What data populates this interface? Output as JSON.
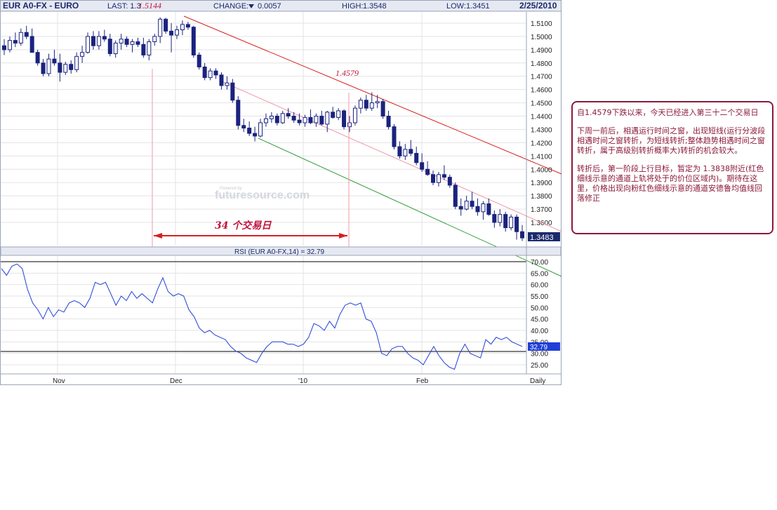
{
  "header": {
    "symbol": "EUR A0-FX - EURO",
    "last_label": "LAST: 1.3",
    "last_annot": "1.5144",
    "change_label": "CHANGE:",
    "change_value": "0.0057",
    "high_label": "HIGH:",
    "high_value": "1.3548",
    "low_label": "LOW:",
    "low_value": "1.3451",
    "date": "2/25/2010"
  },
  "annotations": {
    "peak_label": "1.4579",
    "span_label": "34 个交易日",
    "watermark": "futuresource.com",
    "watermark_small": "Powered by"
  },
  "rsi_label": "RSI (EUR A0-FX,14) = 32.79",
  "rsi_value_tag": "32.79",
  "price_tag": "1.3483",
  "x_labels": [
    "Nov",
    "Dec",
    "'10",
    "Feb",
    "Daily"
  ],
  "price_ticks": [
    "1.5100",
    "1.5000",
    "1.4900",
    "1.4800",
    "1.4700",
    "1.4600",
    "1.4500",
    "1.4400",
    "1.4300",
    "1.4200",
    "1.4100",
    "1.4000",
    "1.3900",
    "1.3800",
    "1.3700",
    "1.3600"
  ],
  "rsi_ticks": [
    "70.00",
    "65.00",
    "60.00",
    "55.00",
    "50.00",
    "45.00",
    "40.00",
    "35.00",
    "30.00",
    "25.00"
  ],
  "note": {
    "p1": "自1.4579下跌以来，今天已经进入第三十二个交易日",
    "p2": "下周一前后，相遇运行时间之窗，出现短线(运行分波段相遇时间之窗转折，为短线转折;整体趋势相遇时间之窗转折，属于高级别转折概率大)转折的机会较大。",
    "p3": "转折后，第一阶段上行目标，暂定为 1.3838附近(红色细线示意的通道上轨将处于的价位区域内)。期待在这里，价格出现向粉红色细线示意的通道安德鲁均值线回落修正"
  },
  "colors": {
    "candle": "#1a237e",
    "red_line": "#d62020",
    "pink_line": "#f09aa8",
    "green_line": "#2e9e3a",
    "rsi_line": "#1f3fd8",
    "annot": "#c0143c",
    "frame": "#8b1a3a"
  },
  "chart_data": [
    {
      "type": "candlestick",
      "title": "EUR A0-FX - EURO",
      "ylim": [
        1.345,
        1.516
      ],
      "candles": [
        [
          1.493,
          1.498,
          1.486,
          1.49
        ],
        [
          1.49,
          1.5,
          1.488,
          1.497
        ],
        [
          1.497,
          1.503,
          1.492,
          1.495
        ],
        [
          1.495,
          1.506,
          1.493,
          1.503
        ],
        [
          1.503,
          1.508,
          1.498,
          1.5
        ],
        [
          1.5,
          1.506,
          1.488,
          1.488
        ],
        [
          1.488,
          1.49,
          1.478,
          1.48
        ],
        [
          1.48,
          1.483,
          1.47,
          1.472
        ],
        [
          1.472,
          1.487,
          1.47,
          1.483
        ],
        [
          1.483,
          1.49,
          1.478,
          1.48
        ],
        [
          1.48,
          1.487,
          1.466,
          1.473
        ],
        [
          1.473,
          1.481,
          1.471,
          1.479
        ],
        [
          1.479,
          1.482,
          1.472,
          1.475
        ],
        [
          1.475,
          1.488,
          1.473,
          1.485
        ],
        [
          1.485,
          1.493,
          1.48,
          1.488
        ],
        [
          1.488,
          1.503,
          1.487,
          1.5
        ],
        [
          1.5,
          1.504,
          1.49,
          1.493
        ],
        [
          1.493,
          1.504,
          1.49,
          1.5
        ],
        [
          1.5,
          1.505,
          1.496,
          1.498
        ],
        [
          1.498,
          1.502,
          1.485,
          1.487
        ],
        [
          1.487,
          1.497,
          1.484,
          1.495
        ],
        [
          1.495,
          1.502,
          1.49,
          1.498
        ],
        [
          1.498,
          1.5,
          1.492,
          1.494
        ],
        [
          1.494,
          1.498,
          1.488,
          1.496
        ],
        [
          1.496,
          1.499,
          1.492,
          1.494
        ],
        [
          1.494,
          1.499,
          1.484,
          1.486
        ],
        [
          1.486,
          1.498,
          1.482,
          1.496
        ],
        [
          1.496,
          1.502,
          1.493,
          1.5
        ],
        [
          1.5,
          1.5144,
          1.495,
          1.513
        ],
        [
          1.513,
          1.514,
          1.502,
          1.504
        ],
        [
          1.504,
          1.51,
          1.488,
          1.501
        ],
        [
          1.501,
          1.508,
          1.498,
          1.505
        ],
        [
          1.505,
          1.512,
          1.501,
          1.509
        ],
        [
          1.509,
          1.511,
          1.505,
          1.507
        ],
        [
          1.507,
          1.508,
          1.484,
          1.486
        ],
        [
          1.486,
          1.488,
          1.475,
          1.477
        ],
        [
          1.477,
          1.48,
          1.467,
          1.469
        ],
        [
          1.469,
          1.476,
          1.467,
          1.474
        ],
        [
          1.474,
          1.476,
          1.468,
          1.471
        ],
        [
          1.471,
          1.473,
          1.46,
          1.463
        ],
        [
          1.463,
          1.47,
          1.46,
          1.465
        ],
        [
          1.465,
          1.468,
          1.45,
          1.452
        ],
        [
          1.452,
          1.455,
          1.43,
          1.433
        ],
        [
          1.433,
          1.438,
          1.428,
          1.431
        ],
        [
          1.431,
          1.436,
          1.425,
          1.427
        ],
        [
          1.427,
          1.432,
          1.421,
          1.425
        ],
        [
          1.425,
          1.438,
          1.424,
          1.435
        ],
        [
          1.435,
          1.442,
          1.432,
          1.438
        ],
        [
          1.438,
          1.443,
          1.435,
          1.44
        ],
        [
          1.44,
          1.442,
          1.433,
          1.435
        ],
        [
          1.435,
          1.444,
          1.434,
          1.442
        ],
        [
          1.442,
          1.446,
          1.438,
          1.44
        ],
        [
          1.44,
          1.443,
          1.435,
          1.437
        ],
        [
          1.437,
          1.442,
          1.433,
          1.435
        ],
        [
          1.435,
          1.441,
          1.432,
          1.439
        ],
        [
          1.439,
          1.445,
          1.434,
          1.435
        ],
        [
          1.435,
          1.442,
          1.432,
          1.44
        ],
        [
          1.44,
          1.444,
          1.433,
          1.434
        ],
        [
          1.434,
          1.444,
          1.428,
          1.443
        ],
        [
          1.443,
          1.447,
          1.438,
          1.439
        ],
        [
          1.439,
          1.446,
          1.437,
          1.444
        ],
        [
          1.444,
          1.445,
          1.43,
          1.432
        ],
        [
          1.432,
          1.44,
          1.428,
          1.435
        ],
        [
          1.435,
          1.448,
          1.433,
          1.446
        ],
        [
          1.446,
          1.454,
          1.442,
          1.452
        ],
        [
          1.452,
          1.456,
          1.444,
          1.446
        ],
        [
          1.446,
          1.4579,
          1.444,
          1.45
        ],
        [
          1.45,
          1.456,
          1.446,
          1.451
        ],
        [
          1.451,
          1.453,
          1.438,
          1.44
        ],
        [
          1.44,
          1.444,
          1.43,
          1.432
        ],
        [
          1.432,
          1.434,
          1.415,
          1.417
        ],
        [
          1.417,
          1.421,
          1.408,
          1.41
        ],
        [
          1.41,
          1.419,
          1.407,
          1.415
        ],
        [
          1.415,
          1.422,
          1.41,
          1.412
        ],
        [
          1.412,
          1.417,
          1.403,
          1.405
        ],
        [
          1.405,
          1.412,
          1.398,
          1.4
        ],
        [
          1.4,
          1.406,
          1.395,
          1.396
        ],
        [
          1.396,
          1.399,
          1.388,
          1.39
        ],
        [
          1.39,
          1.398,
          1.387,
          1.396
        ],
        [
          1.396,
          1.403,
          1.392,
          1.394
        ],
        [
          1.394,
          1.396,
          1.386,
          1.388
        ],
        [
          1.388,
          1.39,
          1.37,
          1.372
        ],
        [
          1.372,
          1.378,
          1.365,
          1.37
        ],
        [
          1.37,
          1.38,
          1.369,
          1.376
        ],
        [
          1.376,
          1.383,
          1.37,
          1.372
        ],
        [
          1.372,
          1.378,
          1.365,
          1.368
        ],
        [
          1.368,
          1.376,
          1.362,
          1.374
        ],
        [
          1.374,
          1.378,
          1.365,
          1.366
        ],
        [
          1.366,
          1.369,
          1.356,
          1.36
        ],
        [
          1.36,
          1.37,
          1.357,
          1.366
        ],
        [
          1.366,
          1.368,
          1.353,
          1.356
        ],
        [
          1.356,
          1.366,
          1.354,
          1.364
        ],
        [
          1.364,
          1.366,
          1.347,
          1.353
        ],
        [
          1.353,
          1.358,
          1.346,
          1.3483
        ]
      ]
    },
    {
      "type": "line",
      "title": "RSI (EUR A0-FX,14) = 32.79",
      "ylim": [
        22,
        72
      ],
      "values": [
        67,
        64,
        68,
        69,
        67,
        58,
        52,
        49,
        45,
        50,
        46,
        49,
        48,
        52,
        53,
        52,
        50,
        54,
        61,
        60,
        61,
        56,
        51,
        55,
        53,
        57,
        54,
        56,
        54,
        52,
        58,
        63,
        57,
        55,
        56,
        55,
        49,
        46,
        41,
        39,
        40,
        38,
        37,
        36,
        33,
        31,
        30,
        28,
        27,
        26,
        30,
        33,
        35,
        35,
        35,
        34,
        34,
        33,
        34,
        37,
        43,
        42,
        40,
        44,
        41,
        47,
        51,
        52,
        51,
        52,
        45,
        44,
        39,
        30,
        29,
        32,
        33,
        33,
        30,
        28,
        27,
        25,
        29,
        33,
        29,
        26,
        24,
        23,
        30,
        34,
        30,
        29,
        28,
        36,
        34,
        37,
        36,
        37,
        35,
        34,
        33
      ]
    }
  ]
}
